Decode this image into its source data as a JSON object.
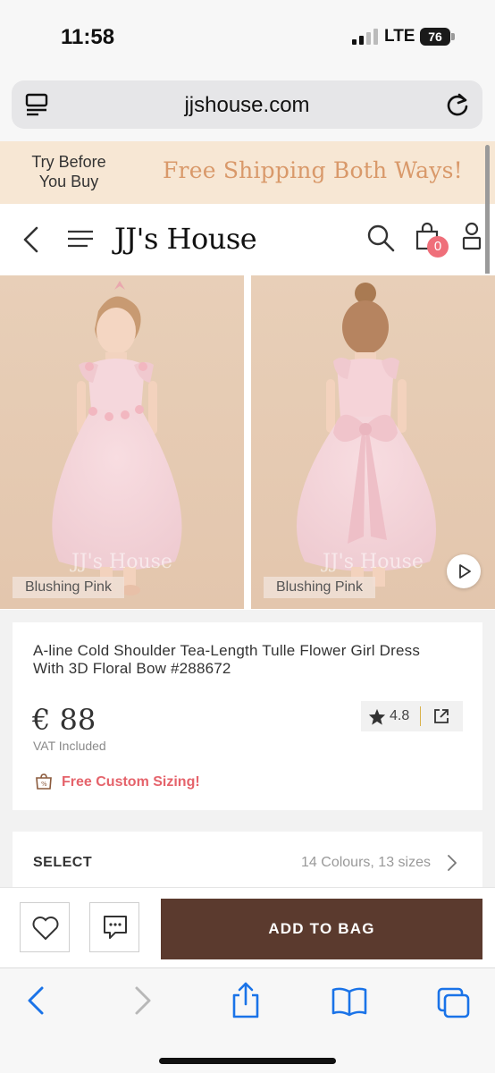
{
  "status_bar": {
    "time": "11:58",
    "network": "LTE",
    "battery": "76"
  },
  "browser": {
    "url": "jjshouse.com"
  },
  "promo": {
    "left_text": "Try Before You Buy",
    "right_text": "Free Shipping Both Ways!"
  },
  "header": {
    "logo": "JJ's House",
    "cart_count": "0"
  },
  "gallery": {
    "images": [
      {
        "label": "Blushing Pink",
        "watermark": "JJ's House"
      },
      {
        "label": "Blushing Pink",
        "watermark": "JJ's House"
      }
    ]
  },
  "product": {
    "title": "A-line Cold Shoulder Tea-Length Tulle Flower Girl Dress With 3D Floral Bow #288672",
    "price": "€ 88",
    "vat": "VAT Included",
    "rating": "4.8",
    "promo_text": "Free Custom Sizing!"
  },
  "select": {
    "label": "SELECT",
    "value": "14 Colours, 13 sizes"
  },
  "actions": {
    "add_to_bag": "ADD TO BAG"
  },
  "colors": {
    "brand_brown": "#5b3a2e",
    "promo_orange": "#d9996a",
    "accent_pink": "#e5636b",
    "badge_pink": "#ef6f7a"
  }
}
